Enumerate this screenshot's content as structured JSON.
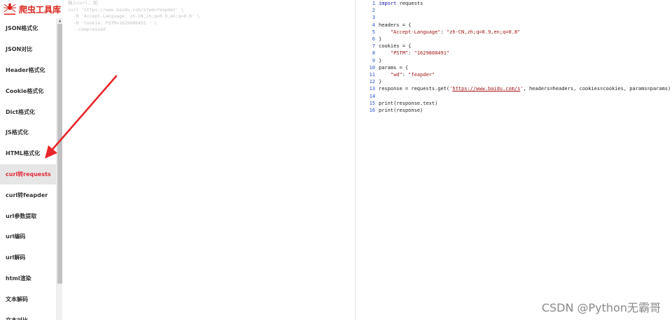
{
  "app": {
    "logo_text": "爬虫工具库",
    "colors": {
      "brand": "#d9261c",
      "active_text": "#e02b3a",
      "active_bg": "#e6e6e6",
      "annotation_arrow": "#e8262b"
    }
  },
  "sidebar": {
    "items": [
      {
        "label": "JSON格式化",
        "active": false
      },
      {
        "label": "JSON对比",
        "active": false
      },
      {
        "label": "Header格式化",
        "active": false
      },
      {
        "label": "Cookie格式化",
        "active": false
      },
      {
        "label": "Dict格式化",
        "active": false
      },
      {
        "label": "JS格式化",
        "active": false
      },
      {
        "label": "HTML格式化",
        "active": false
      },
      {
        "label": "curl转requests",
        "active": true
      },
      {
        "label": "curl转feapder",
        "active": false
      },
      {
        "label": "url参数提取",
        "active": false
      },
      {
        "label": "url编码",
        "active": false
      },
      {
        "label": "url解码",
        "active": false
      },
      {
        "label": "html渲染",
        "active": false
      },
      {
        "label": "文本解码",
        "active": false
      },
      {
        "label": "文本对比",
        "active": false
      }
    ]
  },
  "input": {
    "placeholder_text": "输入curl, 如\ncurl 'https://www.baidu.com/s?wd=feapder' \\\n  -H 'Accept-Language: zh-CN,zh;q=0.9,en;q=0.8' \\\n  -H 'Cookie: PSTM=1629808491 ' \\\n  --compressed"
  },
  "output": {
    "lines": [
      {
        "n": "1",
        "parts": [
          [
            "kw",
            "import"
          ],
          [
            "code",
            " requests"
          ]
        ]
      },
      {
        "n": "2",
        "parts": []
      },
      {
        "n": "3",
        "parts": []
      },
      {
        "n": "4",
        "parts": [
          [
            "code",
            "headers = {"
          ]
        ]
      },
      {
        "n": "5",
        "parts": [
          [
            "code",
            "    "
          ],
          [
            "str",
            "\"Accept-Language\""
          ],
          [
            "code",
            ": "
          ],
          [
            "str",
            "\"zh-CN,zh;q=0.9,en;q=0.8\""
          ]
        ]
      },
      {
        "n": "6",
        "parts": [
          [
            "code",
            "}"
          ]
        ]
      },
      {
        "n": "7",
        "parts": [
          [
            "code",
            "cookies = {"
          ]
        ]
      },
      {
        "n": "8",
        "parts": [
          [
            "code",
            "    "
          ],
          [
            "str",
            "\"PSTM\""
          ],
          [
            "code",
            ": "
          ],
          [
            "str",
            "\"1629808491\""
          ]
        ]
      },
      {
        "n": "9",
        "parts": [
          [
            "code",
            "}"
          ]
        ]
      },
      {
        "n": "10",
        "parts": [
          [
            "code",
            "params = {"
          ]
        ]
      },
      {
        "n": "11",
        "parts": [
          [
            "code",
            "    "
          ],
          [
            "str",
            "\"wd\""
          ],
          [
            "code",
            ": "
          ],
          [
            "str",
            "\"feapder\""
          ]
        ]
      },
      {
        "n": "12",
        "parts": [
          [
            "code",
            "}"
          ]
        ]
      },
      {
        "n": "13",
        "parts": [
          [
            "code",
            "response = requests.get("
          ],
          [
            "str",
            "'"
          ],
          [
            "url",
            "https://www.baidu.com/s"
          ],
          [
            "str",
            "'"
          ],
          [
            "code",
            ", headers=headers, cookies=cookies, params=params)"
          ]
        ]
      },
      {
        "n": "14",
        "parts": []
      },
      {
        "n": "15",
        "parts": [
          [
            "code",
            "print(response.text)"
          ]
        ]
      },
      {
        "n": "16",
        "parts": [
          [
            "code",
            "print(response)"
          ]
        ]
      }
    ]
  },
  "watermark": "CSDN @Python无霸哥"
}
